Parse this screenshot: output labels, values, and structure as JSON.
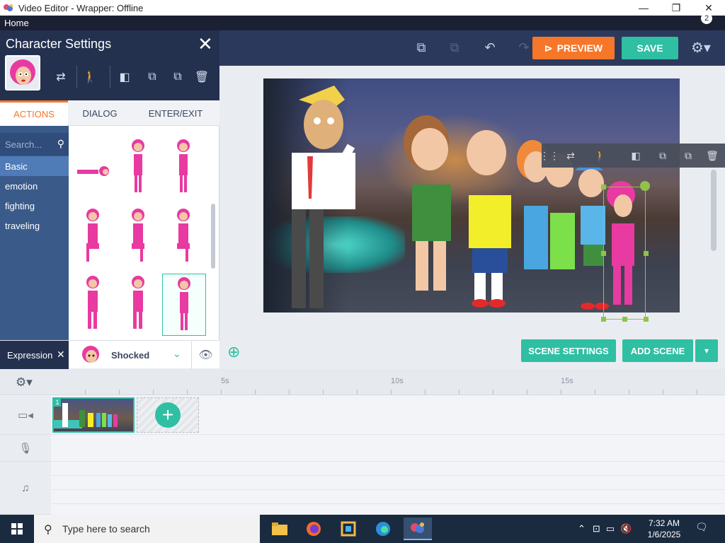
{
  "window": {
    "title": "Video Editor - Wrapper: Offline",
    "minimize_label": "—",
    "maximize_label": "❐",
    "close_label": "✕"
  },
  "menu": {
    "home_label": "Home"
  },
  "toolbar": {
    "preview_label": "PREVIEW",
    "save_label": "SAVE",
    "colors": {
      "preview": "#f6772a",
      "save": "#2fbfa3",
      "toolbar_bg": "#2b3a5c"
    }
  },
  "character_panel": {
    "title": "Character Settings",
    "close_glyph": "✕",
    "tabs": [
      {
        "label": "ACTIONS",
        "active": true
      },
      {
        "label": "DIALOG",
        "active": false
      },
      {
        "label": "ENTER/EXIT",
        "active": false
      }
    ],
    "search_placeholder": "Search...",
    "categories": [
      {
        "label": "Basic",
        "active": true
      },
      {
        "label": "emotion",
        "active": false
      },
      {
        "label": "fighting",
        "active": false
      },
      {
        "label": "traveling",
        "active": false
      }
    ],
    "expression": {
      "label": "Expression",
      "remove_glyph": "✕",
      "value": "Shocked"
    }
  },
  "stage": {
    "scene_settings_label": "SCENE SETTINGS",
    "add_scene_label": "ADD SCENE",
    "add_scene_dropdown_glyph": "▾"
  },
  "timeline": {
    "ruler_labels": [
      "5s",
      "10s",
      "15s"
    ],
    "scene_number": "1",
    "add_glyph": "+"
  },
  "taskbar": {
    "search_placeholder": "Type here to search",
    "time": "7:32 AM",
    "date": "1/6/2025",
    "notification_count": "2"
  }
}
